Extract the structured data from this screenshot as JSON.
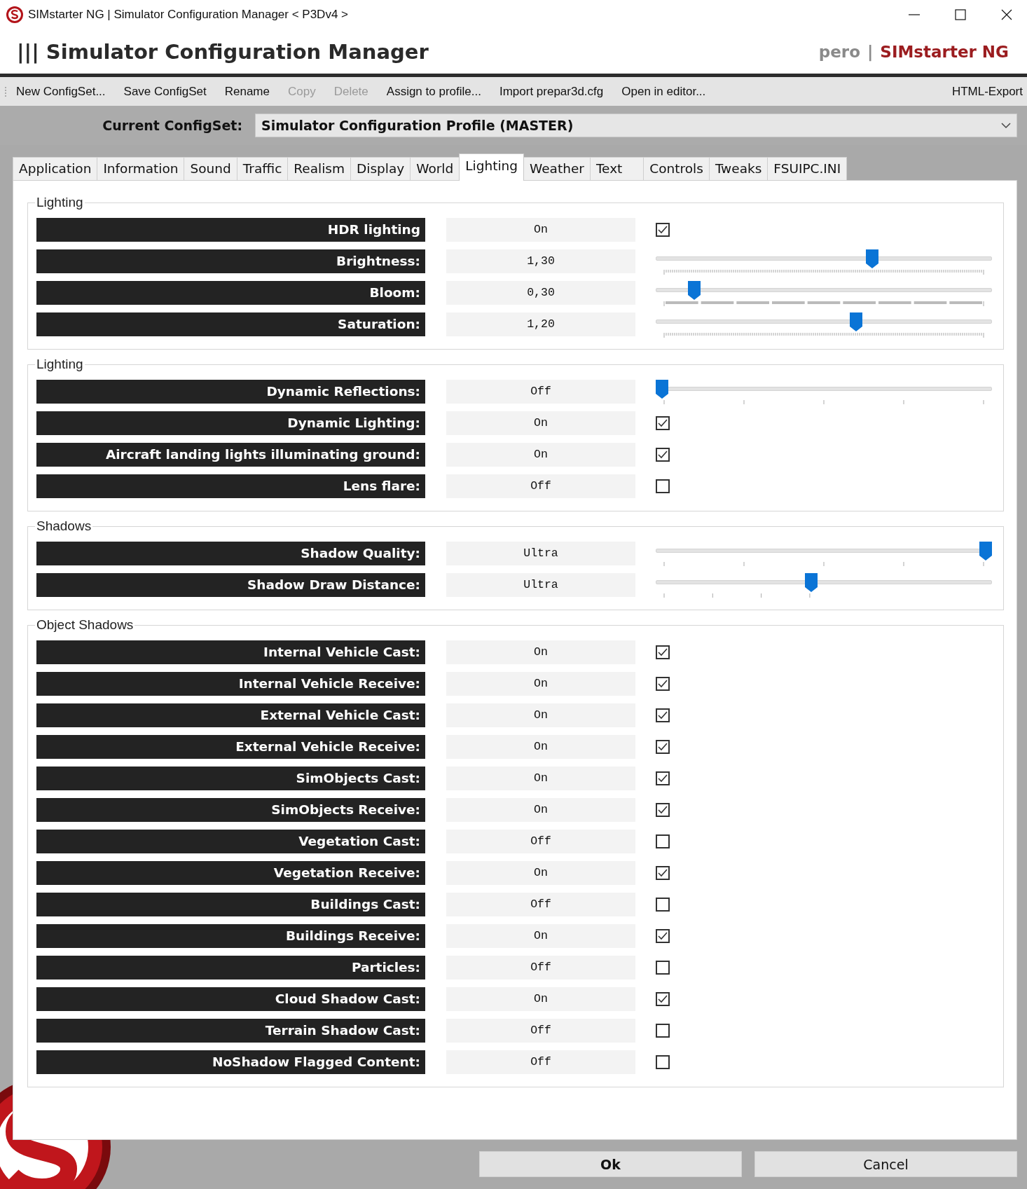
{
  "window": {
    "title": "SIMstarter NG | Simulator Configuration Manager < P3Dv4 >"
  },
  "header": {
    "title": "||| Simulator Configuration Manager",
    "user": "pero",
    "separator": "|",
    "brand": "SIMstarter NG"
  },
  "toolbar": {
    "items": [
      {
        "label": "New ConfigSet...",
        "disabled": false
      },
      {
        "label": "Save ConfigSet",
        "disabled": false
      },
      {
        "label": "Rename",
        "disabled": false
      },
      {
        "label": "Copy",
        "disabled": true
      },
      {
        "label": "Delete",
        "disabled": true
      },
      {
        "label": "Assign to profile...",
        "disabled": false
      },
      {
        "label": "Import prepar3d.cfg",
        "disabled": false
      },
      {
        "label": "Open in editor...",
        "disabled": false
      }
    ],
    "right_item": "HTML-Export"
  },
  "configset": {
    "label": "Current ConfigSet:",
    "value": "Simulator Configuration Profile (MASTER)"
  },
  "tabs": [
    {
      "label": "Application",
      "selected": false
    },
    {
      "label": "Information",
      "selected": false
    },
    {
      "label": "Sound",
      "selected": false
    },
    {
      "label": "Traffic",
      "selected": false
    },
    {
      "label": "Realism",
      "selected": false
    },
    {
      "label": "Display",
      "selected": false
    },
    {
      "label": "World",
      "selected": false
    },
    {
      "label": "Lighting",
      "selected": true
    },
    {
      "label": "Weather",
      "selected": false
    },
    {
      "label": "Text",
      "selected": false
    },
    {
      "label": "Controls",
      "selected": false
    },
    {
      "label": "Tweaks",
      "selected": false
    },
    {
      "label": "FSUIPC.INI",
      "selected": false
    }
  ],
  "sections": [
    {
      "title": "Lighting",
      "rows": [
        {
          "label": "HDR lighting",
          "value": "On",
          "kind": "checkbox",
          "checked": true
        },
        {
          "label": "Brightness:",
          "value": "1,30",
          "kind": "fineslider",
          "level": 0.65
        },
        {
          "label": "Bloom:",
          "value": "0,30",
          "kind": "barslider",
          "level": 0.1
        },
        {
          "label": "Saturation:",
          "value": "1,20",
          "kind": "fineslider",
          "level": 0.6
        }
      ]
    },
    {
      "title": "Lighting",
      "rows": [
        {
          "label": "Dynamic Reflections:",
          "value": "Off",
          "kind": "quarterslider",
          "level": 0
        },
        {
          "label": "Dynamic Lighting:",
          "value": "On",
          "kind": "checkbox",
          "checked": true
        },
        {
          "label": "Aircraft landing lights illuminating ground:",
          "value": "On",
          "kind": "checkbox",
          "checked": true
        },
        {
          "label": "Lens flare:",
          "value": "Off",
          "kind": "checkbox",
          "checked": false
        }
      ]
    },
    {
      "title": "Shadows",
      "rows": [
        {
          "label": "Shadow Quality:",
          "value": "Ultra",
          "kind": "quarterslider",
          "level": 1
        },
        {
          "label": "Shadow Draw Distance:",
          "value": "Ultra",
          "kind": "stepslider",
          "level": 0.46
        }
      ]
    },
    {
      "title": "Object Shadows",
      "rows": [
        {
          "label": "Internal Vehicle Cast:",
          "value": "On",
          "kind": "checkbox",
          "checked": true
        },
        {
          "label": "Internal Vehicle Receive:",
          "value": "On",
          "kind": "checkbox",
          "checked": true
        },
        {
          "label": "External Vehicle Cast:",
          "value": "On",
          "kind": "checkbox",
          "checked": true
        },
        {
          "label": "External Vehicle Receive:",
          "value": "On",
          "kind": "checkbox",
          "checked": true
        },
        {
          "label": "SimObjects Cast:",
          "value": "On",
          "kind": "checkbox",
          "checked": true
        },
        {
          "label": "SimObjects Receive:",
          "value": "On",
          "kind": "checkbox",
          "checked": true
        },
        {
          "label": "Vegetation Cast:",
          "value": "Off",
          "kind": "checkbox",
          "checked": false
        },
        {
          "label": "Vegetation Receive:",
          "value": "On",
          "kind": "checkbox",
          "checked": true
        },
        {
          "label": "Buildings Cast:",
          "value": "Off",
          "kind": "checkbox",
          "checked": false
        },
        {
          "label": "Buildings Receive:",
          "value": "On",
          "kind": "checkbox",
          "checked": true
        },
        {
          "label": "Particles:",
          "value": "Off",
          "kind": "checkbox",
          "checked": false
        },
        {
          "label": "Cloud Shadow Cast:",
          "value": "On",
          "kind": "checkbox",
          "checked": true
        },
        {
          "label": "Terrain Shadow Cast:",
          "value": "Off",
          "kind": "checkbox",
          "checked": false
        },
        {
          "label": "NoShadow Flagged Content:",
          "value": "Off",
          "kind": "checkbox",
          "checked": false
        }
      ]
    }
  ],
  "buttons": [
    {
      "label": "Ok",
      "default": true
    },
    {
      "label": "Cancel",
      "default": false
    }
  ]
}
